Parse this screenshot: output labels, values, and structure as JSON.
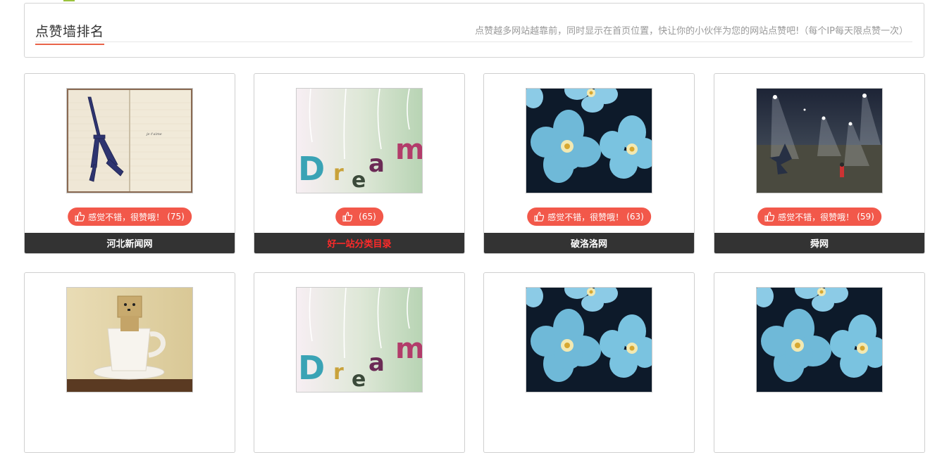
{
  "header": {
    "title": "点赞墙排名",
    "description": "点赞越多网站越靠前，同时显示在首页位置，快让你的小伙伴为您的网站点赞吧!（每个IP每天限点赞一次）"
  },
  "cards": [
    {
      "image": "eiffel-notebook",
      "like_text": "感觉不错，很赞哦！",
      "like_count": "(75)",
      "name": "河北新闻网",
      "name_color": "#ffffff"
    },
    {
      "image": "dream-letters",
      "like_text": "",
      "like_count": "(65)",
      "name": "好一站分类目录",
      "name_color": "#ff2a2a"
    },
    {
      "image": "blue-flowers",
      "like_text": "感觉不错，很赞哦！",
      "like_count": "(63)",
      "name": "破洛洛网",
      "name_color": "#ffffff"
    },
    {
      "image": "night-field",
      "like_text": "感觉不错，很赞哦！",
      "like_count": "(59)",
      "name": "舜网",
      "name_color": "#ffffff"
    },
    {
      "image": "danbo-cup",
      "like_text": "",
      "like_count": "",
      "name": "",
      "name_color": "#ffffff"
    },
    {
      "image": "dream-letters",
      "like_text": "",
      "like_count": "",
      "name": "",
      "name_color": "#ffffff"
    },
    {
      "image": "blue-flowers",
      "like_text": "",
      "like_count": "",
      "name": "",
      "name_color": "#ffffff"
    },
    {
      "image": "blue-flowers",
      "like_text": "",
      "like_count": "",
      "name": "",
      "name_color": "#ffffff"
    }
  ],
  "icons": {
    "like": "thumbs-up-icon"
  },
  "colors": {
    "accent": "#f2584a",
    "name_bar": "#333333",
    "title_underline": "#e8644a"
  }
}
